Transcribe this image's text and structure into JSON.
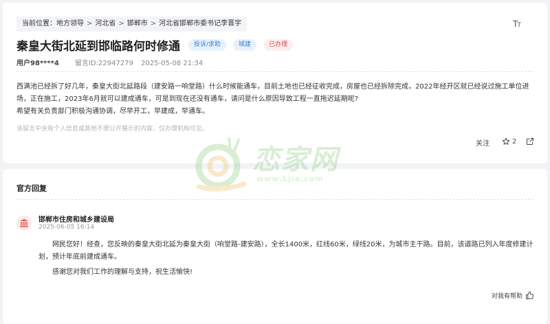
{
  "breadcrumb": {
    "prefix": "当前位置：",
    "items": [
      "地方领导",
      "河北省",
      "邯郸市",
      "河北省邯郸市委书记李晋宇"
    ],
    "separator": ">"
  },
  "toolbar": {
    "font_size_icon": "font-size-icon"
  },
  "post": {
    "title": "秦皇大街北延到邯临路何时修通",
    "tags": [
      "投诉/求助",
      "城建",
      "已办理"
    ],
    "user": "用户98****4",
    "message_id": "留言ID:22947279",
    "time": "2025-05-08 21:34",
    "content": [
      "西满池已经拆了好几年，秦皇大街北延路段（建安路一响堂路）什么时候能通车，目前土地也已经征收完成，房屋也已经拆除完成，2022年经开区就已经说过施工单位进场，正在施工，2023年6月就可以建成通车，可是到现在还没有通车，请问是什么原因导致工程一直拖迟延期呢?",
      "希望有关负责部门积极沟通协调，尽早开工，早建成，早通车。"
    ],
    "disclaimer": "该留言中含有个人信息或其他不便公开展示的内容，仅办理机构可见。",
    "actions": {
      "follow": "关注",
      "star_count": "2"
    }
  },
  "watermark": {
    "text": "恋家网",
    "url": "www.Ljia.com"
  },
  "reply": {
    "heading": "官方回复",
    "org": "邯郸市住房和城乡建设局",
    "time": "2025-06-05 16:14",
    "paragraphs": [
      "网民您好！经查，您反映的秦皇大街北延为秦皇大街（响堂路-建安路），全长1400米，红线60米，绿线20米，为城市主干路。目前，该道路已列入年度修建计划，预计年底前建成通车。",
      "感谢您对我们工作的理解与支持，祝生活愉快!"
    ],
    "helpful": "对我有帮助"
  },
  "colors": {
    "tag_blue_bg": "#e8f1fb",
    "tag_blue_text": "#3b7fd1",
    "tag_red_bg": "#fdeeee",
    "tag_red_text": "#e0484b",
    "org_icon": "#d9534f"
  }
}
